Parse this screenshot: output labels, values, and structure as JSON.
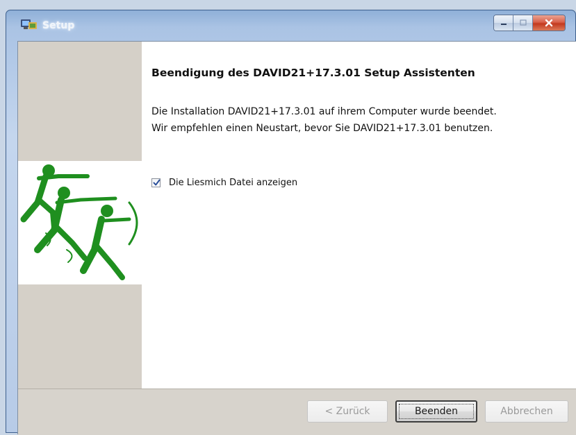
{
  "window": {
    "title": "Setup"
  },
  "main": {
    "heading": "Beendigung des DAVID21+17.3.01 Setup Assistenten",
    "line1": "Die Installation DAVID21+17.3.01 auf ihrem Computer wurde beendet.",
    "line2": "Wir empfehlen einen Neustart, bevor Sie  DAVID21+17.3.01 benutzen.",
    "checkbox": {
      "label": "Die Liesmich Datei anzeigen",
      "checked": true
    }
  },
  "buttons": {
    "back": "< Zurück",
    "finish": "Beenden",
    "cancel": "Abbrechen"
  },
  "colors": {
    "logo_green": "#1f8f1f",
    "side_panel": "#d5d0c8",
    "close_button": "#c8432a"
  }
}
